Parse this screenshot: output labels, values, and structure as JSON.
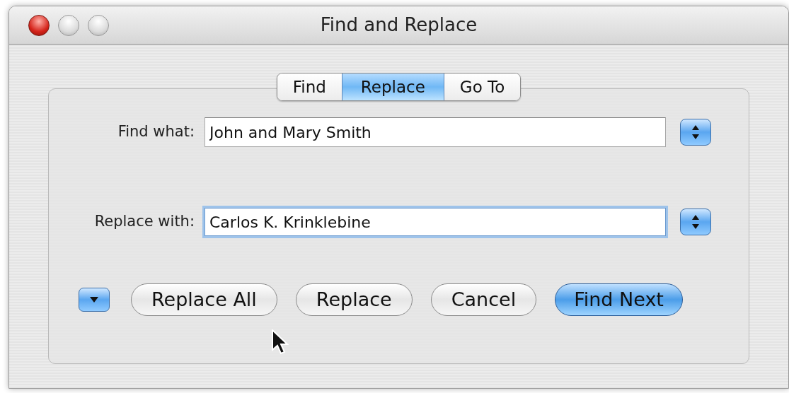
{
  "window": {
    "title": "Find and Replace"
  },
  "tabs": [
    {
      "label": "Find",
      "selected": false
    },
    {
      "label": "Replace",
      "selected": true
    },
    {
      "label": "Go To",
      "selected": false
    }
  ],
  "fields": [
    {
      "label": "Find what:",
      "value": "John and Mary Smith",
      "focused": false
    },
    {
      "label": "Replace with:",
      "value": "Carlos K. Krinklebine",
      "focused": true
    }
  ],
  "buttons": [
    {
      "label": "Replace All",
      "default": false
    },
    {
      "label": "Replace",
      "default": false
    },
    {
      "label": "Cancel",
      "default": false
    },
    {
      "label": "Find Next",
      "default": true
    }
  ]
}
